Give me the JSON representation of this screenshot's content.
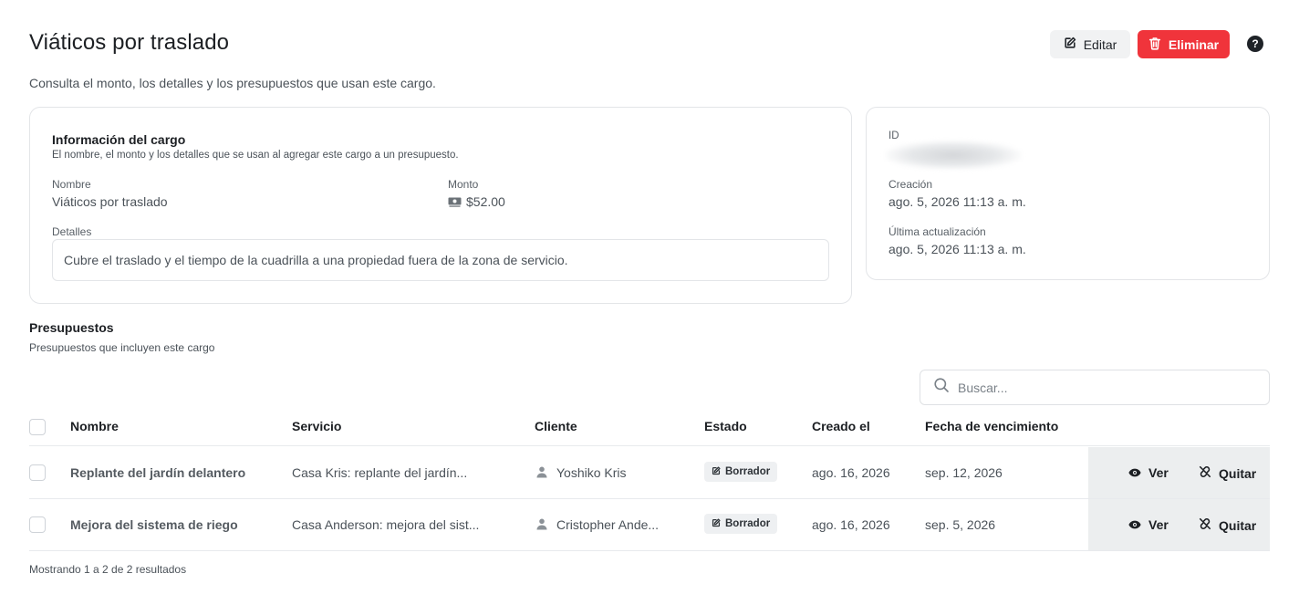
{
  "header": {
    "title": "Viáticos por traslado",
    "subtitle": "Consulta el monto, los detalles y los presupuestos que usan este cargo.",
    "edit_label": "Editar",
    "delete_label": "Eliminar",
    "help_glyph": "?",
    "delete_color": "#f0343b"
  },
  "info_card": {
    "heading": "Información del cargo",
    "description": "El nombre, el monto y los detalles que se usan al agregar este cargo a un presupuesto.",
    "name_label": "Nombre",
    "name_value": "Viáticos por traslado",
    "amount_label": "Monto",
    "amount_value": "$52.00",
    "details_label": "Detalles",
    "details_value": "Cubre el traslado y el tiempo de la cuadrilla a una propiedad fuera de la zona de servicio."
  },
  "meta_card": {
    "id_label": "ID",
    "created_label": "Creación",
    "created_value": "ago. 5, 2026 11:13 a. m.",
    "updated_label": "Última actualización",
    "updated_value": "ago. 5, 2026 11:13 a. m."
  },
  "budgets": {
    "heading": "Presupuestos",
    "description": "Presupuestos que incluyen este cargo",
    "search_placeholder": "Buscar...",
    "columns": {
      "name": "Nombre",
      "service": "Servicio",
      "client": "Cliente",
      "status": "Estado",
      "created": "Creado el",
      "due": "Fecha de vencimiento"
    },
    "rows": [
      {
        "name": "Replante del jardín delantero",
        "service": "Casa Kris: replante del jardín...",
        "client": "Yoshiko Kris",
        "status": "Borrador",
        "created": "ago. 16, 2026",
        "due": "sep. 12, 2026",
        "view_label": "Ver",
        "remove_label": "Quitar"
      },
      {
        "name": "Mejora del sistema de riego",
        "service": "Casa Anderson: mejora del sist...",
        "client": "Cristopher Ande...",
        "status": "Borrador",
        "created": "ago. 16, 2026",
        "due": "sep. 5, 2026",
        "view_label": "Ver",
        "remove_label": "Quitar"
      }
    ],
    "footer": "Mostrando 1 a 2 de 2 resultados"
  }
}
